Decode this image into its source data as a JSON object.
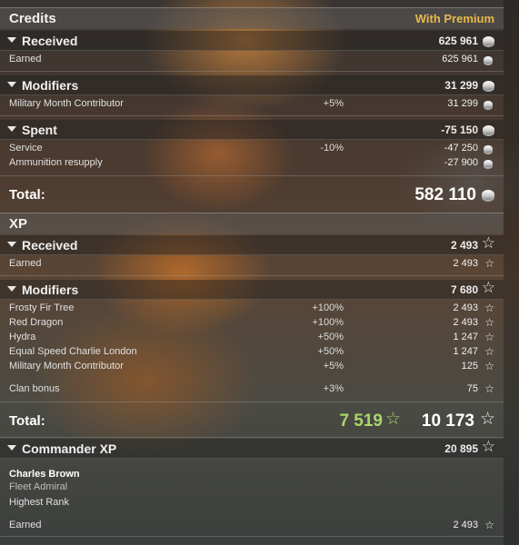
{
  "credits": {
    "title": "Credits",
    "premium_label": "With Premium",
    "received": {
      "title": "Received",
      "total": "625 961",
      "items": [
        {
          "label": "Earned",
          "value": "625 961"
        }
      ]
    },
    "modifiers": {
      "title": "Modifiers",
      "total": "31 299",
      "items": [
        {
          "label": "Military Month Contributor",
          "mod": "+5%",
          "value": "31 299"
        }
      ]
    },
    "spent": {
      "title": "Spent",
      "total": "-75 150",
      "items": [
        {
          "label": "Service",
          "mod": "-10%",
          "value": "-47 250"
        },
        {
          "label": "Ammunition resupply",
          "mod": "",
          "value": "-27 900"
        }
      ]
    },
    "total_label": "Total:",
    "total_value": "582 110"
  },
  "xp": {
    "title": "XP",
    "received": {
      "title": "Received",
      "total": "2 493",
      "items": [
        {
          "label": "Earned",
          "value": "2 493"
        }
      ]
    },
    "modifiers": {
      "title": "Modifiers",
      "total": "7 680",
      "items": [
        {
          "label": "Frosty Fir Tree",
          "mod": "+100%",
          "value": "2 493"
        },
        {
          "label": "Red Dragon",
          "mod": "+100%",
          "value": "2 493"
        },
        {
          "label": "Hydra",
          "mod": "+50%",
          "value": "1 247"
        },
        {
          "label": "Equal Speed Charlie London",
          "mod": "+50%",
          "value": "1 247"
        },
        {
          "label": "Military Month Contributor",
          "mod": "+5%",
          "value": "125"
        },
        {
          "label": "Clan bonus",
          "mod": "+3%",
          "value": "75"
        }
      ]
    },
    "total_label": "Total:",
    "total_base": "7 519",
    "total_premium": "10 173"
  },
  "commander_xp": {
    "title": "Commander XP",
    "total": "20 895",
    "name": "Charles Brown",
    "rank": "Fleet Admiral",
    "status": "Highest Rank",
    "earned_label": "Earned",
    "earned_value": "2 493"
  },
  "icons": {
    "credit": "credit-coin-icon",
    "xp": "star-icon",
    "collapse": "chevron-down-icon"
  },
  "colors": {
    "premium": "#e7b84a",
    "base_total": "#a8d66a"
  }
}
